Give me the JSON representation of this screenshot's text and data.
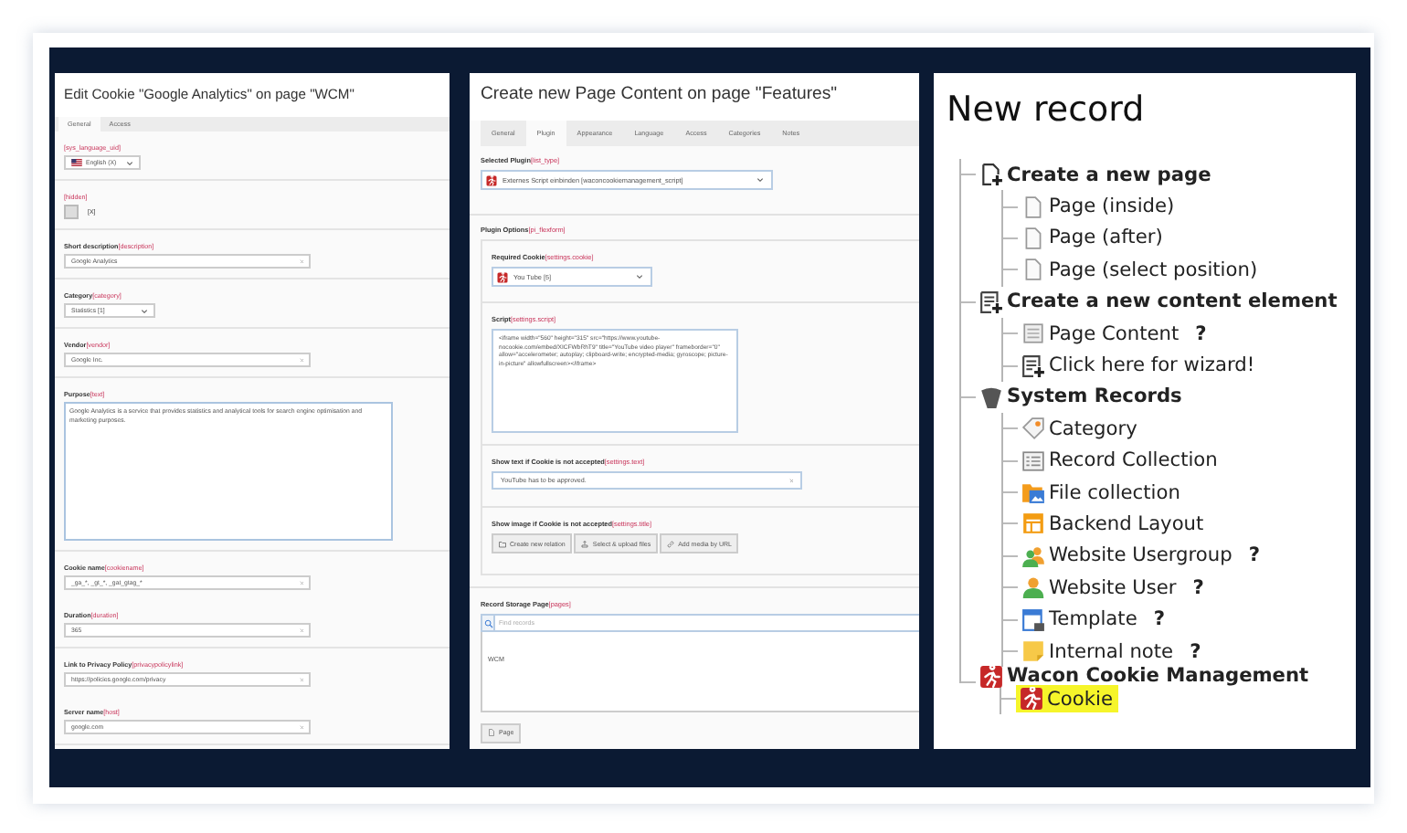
{
  "left": {
    "title": "Edit Cookie \"Google Analytics\" on page \"WCM\"",
    "tabs": [
      {
        "label": "General",
        "selected": true
      },
      {
        "label": "Access",
        "selected": false
      }
    ],
    "sections": [
      {
        "fields": [
          {
            "kind": "language",
            "key": "[sys_language_uid]",
            "value": "English (X)"
          }
        ]
      },
      {
        "fields": [
          {
            "kind": "checkbox",
            "key": "[hidden]",
            "value": "[X]",
            "checked": false
          }
        ]
      },
      {
        "fields": [
          {
            "kind": "text",
            "label": "Short description",
            "key": "[description]",
            "value": "Google Analytics"
          }
        ]
      },
      {
        "fields": [
          {
            "kind": "select",
            "label": "Category",
            "key": "[category]",
            "value": "Statistics [1]"
          }
        ]
      },
      {
        "fields": [
          {
            "kind": "text",
            "label": "Vendor",
            "key": "[vendor]",
            "value": "Google Inc."
          }
        ]
      },
      {
        "fields": [
          {
            "kind": "textarea",
            "label": "Purpose",
            "key": "[text]",
            "value": "Google Analytics is a service that provides statistics and analytical tools for search engine optimisation and marketing purposes."
          }
        ]
      },
      {
        "fields": [
          {
            "kind": "text",
            "label": "Cookie name",
            "key": "[cookiename]",
            "value": "_ga_*, _gt_*, _gat_gtag_*"
          },
          {
            "kind": "text",
            "label": "Duration",
            "key": "[duration]",
            "value": "365"
          }
        ]
      },
      {
        "fields": [
          {
            "kind": "text",
            "label": "Link to Privacy Policy",
            "key": "[privacypolicylink]",
            "value": "https://policies.google.com/privacy"
          },
          {
            "kind": "text",
            "label": "Server name",
            "key": "[host]",
            "value": "google.com"
          }
        ]
      }
    ]
  },
  "middle": {
    "title": "Create new Page Content on page \"Features\"",
    "tabs": [
      {
        "label": "General",
        "selected": false
      },
      {
        "label": "Plugin",
        "selected": true
      },
      {
        "label": "Appearance",
        "selected": false
      },
      {
        "label": "Language",
        "selected": false
      },
      {
        "label": "Access",
        "selected": false
      },
      {
        "label": "Categories",
        "selected": false
      },
      {
        "label": "Notes",
        "selected": false
      }
    ],
    "plugin": {
      "label": "Selected Plugin",
      "key": "[list_type]",
      "value": "Externes Script einbinden [waconcookiemanagement_script]"
    },
    "options": {
      "label": "Plugin Options",
      "key": "[pi_flexform]",
      "fields": [
        {
          "kind": "select",
          "label": "Required Cookie",
          "key": "[settings.cookie]",
          "value": "You Tube [5]"
        },
        {
          "kind": "textarea",
          "label": "Script",
          "key": "[settings.script]",
          "value": "<iframe width=\"560\" height=\"315\" src=\"https://www.youtube-nocookie.com/embed/XICFWbRhT9\" title=\"YouTube video player\" frameborder=\"0\" allow=\"accelerometer; autoplay; clipboard-write; encrypted-media; gyroscope; picture-in-picture\" allowfullscreen></iframe>"
        },
        {
          "kind": "text",
          "label": "Show text if Cookie is not accepted",
          "key": "[settings.text]",
          "value": "YouTube has to be approved."
        },
        {
          "kind": "buttons",
          "label": "Show image if Cookie is not accepted",
          "key": "[settings.title]",
          "buttons": [
            "Create new relation",
            "Select & upload files",
            "Add media by URL"
          ]
        }
      ]
    },
    "storage": {
      "label": "Record Storage Page",
      "key": "[pages]",
      "placeholder": "Find records",
      "records": [
        "WCM"
      ],
      "button": "Page"
    }
  },
  "right": {
    "title": "New record",
    "tree": [
      {
        "kind": "page-new",
        "label": "Create a new page",
        "selected": false,
        "children": [
          {
            "kind": "page",
            "label": "Page (inside)",
            "selected": false
          },
          {
            "kind": "page",
            "label": "Page (after)",
            "selected": false
          },
          {
            "kind": "page",
            "label": "Page (select position)",
            "selected": false
          }
        ]
      },
      {
        "kind": "content-new",
        "label": "Create a new content element",
        "selected": false,
        "children": [
          {
            "kind": "content",
            "label": "Page Content",
            "help": "?",
            "selected": false
          },
          {
            "kind": "content-new",
            "label": "Click here for wizard!",
            "selected": false
          }
        ]
      },
      {
        "kind": "typo3",
        "label": "System Records",
        "selected": false,
        "children": [
          {
            "kind": "category",
            "label": "Category",
            "selected": false
          },
          {
            "kind": "collection",
            "label": "Record Collection",
            "selected": false
          },
          {
            "kind": "folder",
            "label": "File collection",
            "selected": false
          },
          {
            "kind": "layout",
            "label": "Backend Layout",
            "selected": false
          },
          {
            "kind": "usergroup",
            "label": "Website Usergroup",
            "help": "?",
            "selected": false
          },
          {
            "kind": "user",
            "label": "Website User",
            "help": "?",
            "selected": false
          },
          {
            "kind": "template",
            "label": "Template",
            "help": "?",
            "selected": false
          },
          {
            "kind": "note",
            "label": "Internal note",
            "help": "?",
            "selected": false
          }
        ]
      },
      {
        "kind": "wacon",
        "label": "Wacon Cookie Management",
        "selected": false,
        "children": [
          {
            "kind": "wacon",
            "label": "Cookie",
            "selected": true
          }
        ]
      }
    ]
  }
}
